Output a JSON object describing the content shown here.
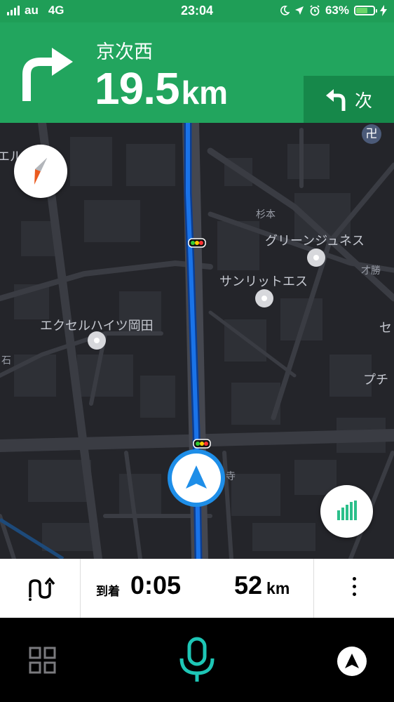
{
  "status_bar": {
    "carrier": "au",
    "network": "4G",
    "time": "23:04",
    "battery": "63%",
    "battery_level": 0.63
  },
  "nav_header": {
    "street": "京次西",
    "distance_value": "19.5",
    "distance_unit": "km",
    "next_label": "次",
    "color": "#22a55e"
  },
  "map": {
    "labels": {
      "label_1": "エルフ",
      "label_2": "杉本",
      "label_3": "グリーンジュネス",
      "label_4": "サンリットエス",
      "label_5": "才勝",
      "label_6": "セ",
      "label_7": "エクセルハイツ岡田",
      "label_8": "石",
      "label_9": "プチ",
      "label_10": "寺"
    },
    "shrine_symbol": "卍",
    "route_color": "#1a73e8"
  },
  "trip_bar": {
    "arrival_label": "到着",
    "arrival_time": "0:05",
    "remaining_distance": "52",
    "remaining_unit": "km"
  },
  "icons": [
    "status-bar-signal-icon",
    "location-arrow-icon",
    "moon-icon",
    "alarm-icon",
    "battery-icon",
    "charging-icon",
    "turn-right-icon",
    "turn-left-icon",
    "compass-icon",
    "traffic-light-icon",
    "current-location-icon",
    "stats-bars-icon",
    "route-options-icon",
    "more-vertical-icon",
    "grid-menu-icon",
    "microphone-icon",
    "navigation-arrow-icon"
  ],
  "accent_colors": {
    "nav_blue": "#1e8ee8",
    "mic_teal": "#1ec6b6",
    "stats_green": "#2bbf8a"
  }
}
